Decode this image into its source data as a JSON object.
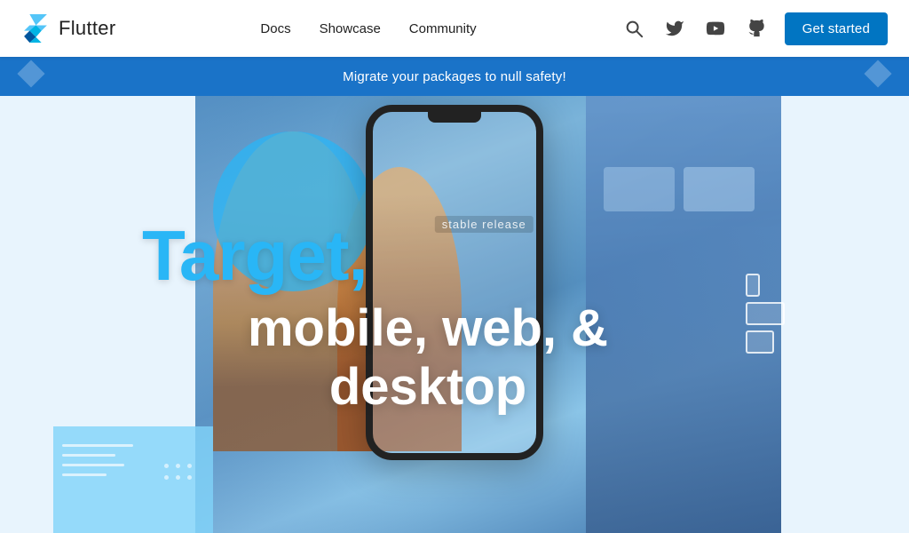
{
  "navbar": {
    "brand": "Flutter",
    "nav_links": [
      {
        "id": "docs",
        "label": "Docs"
      },
      {
        "id": "showcase",
        "label": "Showcase"
      },
      {
        "id": "community",
        "label": "Community"
      }
    ],
    "cta_label": "Get started",
    "icons": {
      "search": "search-icon",
      "twitter": "twitter-icon",
      "youtube": "youtube-icon",
      "github": "github-icon"
    }
  },
  "banner": {
    "text": "Migrate your packages to null safety!",
    "arrow_left": "◆",
    "arrow_right": "◆"
  },
  "hero": {
    "tag": "stable release",
    "title_highlight": "Target,",
    "subtitle_line1": "mobile, web, &",
    "subtitle_line2": "desktop"
  },
  "colors": {
    "flutter_blue": "#0175C2",
    "banner_blue": "#1a73c8",
    "hero_light_blue": "#29b6f6",
    "white": "#ffffff"
  }
}
